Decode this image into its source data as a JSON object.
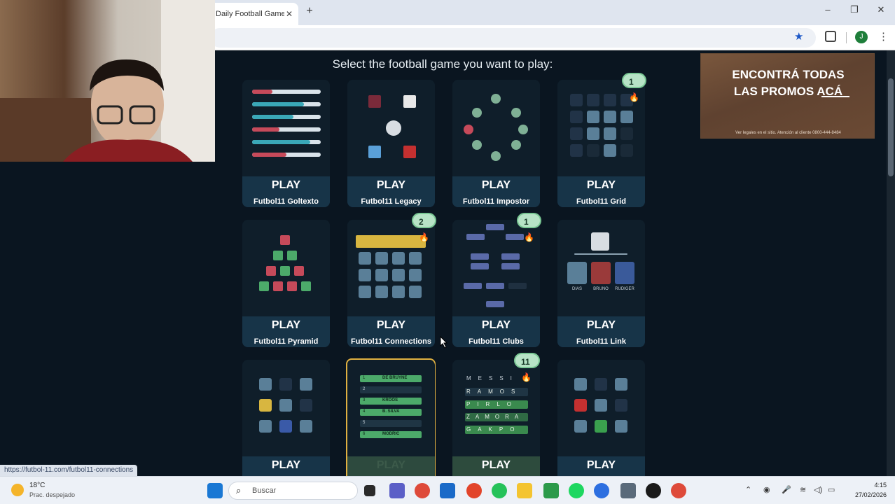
{
  "browser": {
    "tab_title": "Daily Football Game",
    "tab_close": "✕",
    "new_tab": "+",
    "minimize": "–",
    "maximize": "❐",
    "close": "✕",
    "profile_letter": "J"
  },
  "page": {
    "heading": "Select the football game you want to play:",
    "ad": {
      "line1": "ENCONTRÁ TODAS",
      "line2": "LAS PROMOS ACÁ",
      "fine": "Ver legales en el sitio. Atención al cliente 0800-444-8484"
    },
    "cards": [
      {
        "play": "PLAY",
        "name": "Futbol11 Goltexto"
      },
      {
        "play": "PLAY",
        "name": "Futbol11 Legacy"
      },
      {
        "play": "PLAY",
        "name": "Futbol11 Impostor"
      },
      {
        "play": "PLAY",
        "name": "Futbol11 Grid",
        "badge": "1"
      },
      {
        "play": "PLAY",
        "name": "Futbol11 Pyramid"
      },
      {
        "play": "PLAY",
        "name": "Futbol11 Connections",
        "badge": "2"
      },
      {
        "play": "PLAY",
        "name": "Futbol11 Clubs",
        "badge": "1"
      },
      {
        "play": "PLAY",
        "name": "Futbol11 Link"
      },
      {
        "play": "PLAY",
        "name": ""
      },
      {
        "play": "PLAY",
        "name": ""
      },
      {
        "play": "PLAY",
        "name": "",
        "badge": "11"
      },
      {
        "play": "PLAY",
        "name": ""
      }
    ],
    "fire": "🔥",
    "link_players": [
      "DIAS",
      "BRUNO",
      "RUDIGER"
    ],
    "legacy_rows": [
      "DE BRUYNE",
      "",
      "KROOS",
      "B. SILVA",
      "",
      "MODRIC"
    ],
    "legacy_nums": [
      "1",
      "2",
      "3",
      "4",
      "5",
      "6"
    ],
    "wordle_rows": [
      "MESSI",
      "RAMOS",
      "PIRLO",
      "ZAMORA",
      "GAKPO"
    ]
  },
  "status_url": "https://futbol-11.com/futbol11-connections",
  "taskbar": {
    "temp": "18°C",
    "condition": "Prac. despejado",
    "search_placeholder": "Buscar",
    "time": "4:15",
    "date": "27/02/2026"
  }
}
